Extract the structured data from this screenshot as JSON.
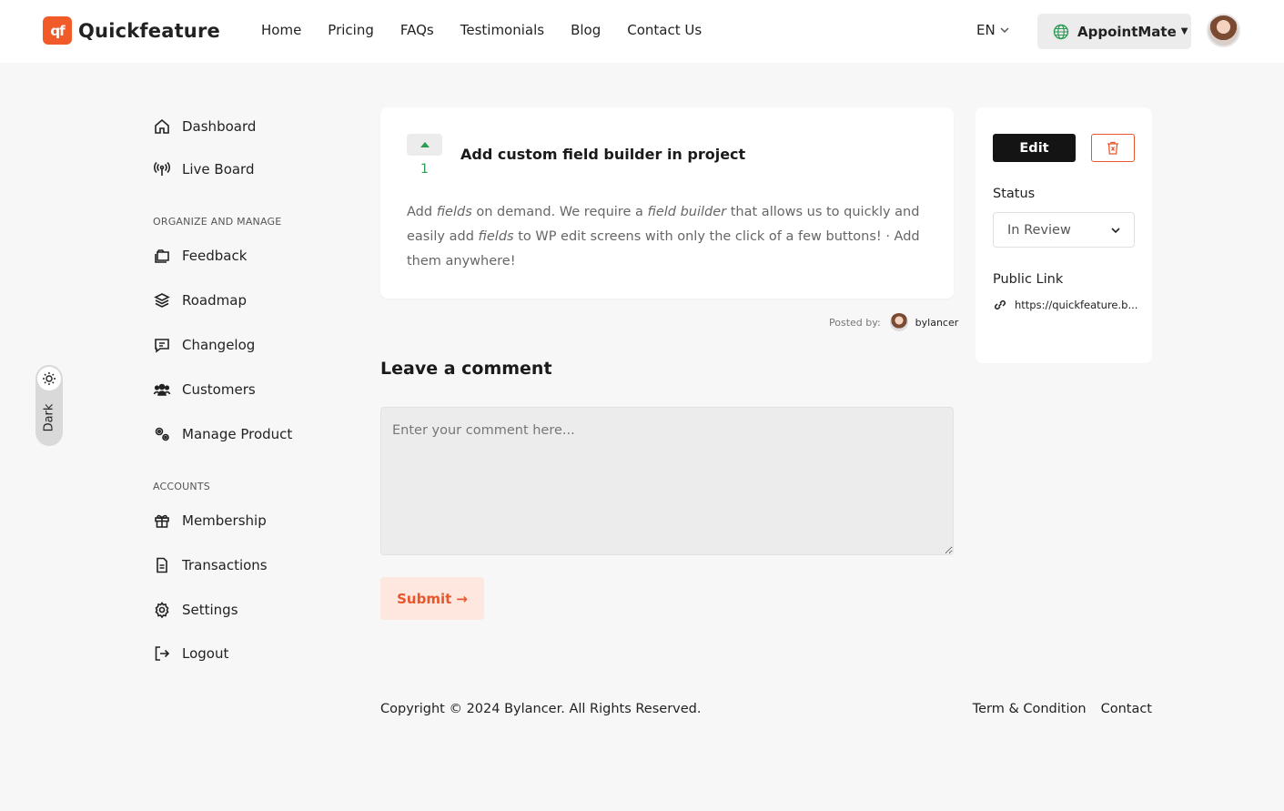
{
  "brand": {
    "name": "Quickfeature",
    "mark": "qf",
    "accent": "#f15a29"
  },
  "nav": [
    {
      "label": "Home"
    },
    {
      "label": "Pricing"
    },
    {
      "label": "FAQs"
    },
    {
      "label": "Testimonials"
    },
    {
      "label": "Blog"
    },
    {
      "label": "Contact Us"
    }
  ],
  "header": {
    "language": "EN",
    "workspace": "AppointMate"
  },
  "theme_toggle": {
    "label": "Dark",
    "icon": "sun-icon"
  },
  "sidebar": {
    "top_items": [
      {
        "label": "Dashboard",
        "icon": "home-icon"
      },
      {
        "label": "Live Board",
        "icon": "broadcast-icon"
      }
    ],
    "sections": [
      {
        "heading": "ORGANIZE AND MANAGE",
        "items": [
          {
            "label": "Feedback",
            "icon": "folders-icon"
          },
          {
            "label": "Roadmap",
            "icon": "layers-icon"
          },
          {
            "label": "Changelog",
            "icon": "message-square-icon"
          },
          {
            "label": "Customers",
            "icon": "users-icon"
          },
          {
            "label": "Manage Product",
            "icon": "gears-icon"
          }
        ]
      },
      {
        "heading": "ACCOUNTS",
        "items": [
          {
            "label": "Membership",
            "icon": "gift-icon"
          },
          {
            "label": "Transactions",
            "icon": "document-icon"
          },
          {
            "label": "Settings",
            "icon": "gear-icon"
          },
          {
            "label": "Logout",
            "icon": "logout-icon"
          }
        ]
      }
    ]
  },
  "post": {
    "votes": "1",
    "title": "Add custom field builder in project",
    "body_parts": [
      {
        "text": "Add ",
        "em": false
      },
      {
        "text": "fields",
        "em": true
      },
      {
        "text": " on demand. We require a ",
        "em": false
      },
      {
        "text": "field builder",
        "em": true
      },
      {
        "text": " that allows us to quickly and easily add ",
        "em": false
      },
      {
        "text": "fields",
        "em": true
      },
      {
        "text": " to WP edit screens with only the click of a few buttons! · Add them anywhere!",
        "em": false
      }
    ],
    "posted_by_label": "Posted by:",
    "author": "bylancer"
  },
  "comment": {
    "heading": "Leave a comment",
    "placeholder": "Enter your comment here...",
    "submit_label": "Submit",
    "submit_arrow": "→"
  },
  "side_panel": {
    "edit_label": "Edit",
    "status_label": "Status",
    "status_value": "In Review",
    "public_link_label": "Public Link",
    "public_link_url": "https://quickfeature.b..."
  },
  "footer": {
    "copyright": "Copyright © 2024 Bylancer. All Rights Reserved.",
    "links": [
      {
        "label": "Term & Condition"
      },
      {
        "label": "Contact"
      }
    ]
  }
}
